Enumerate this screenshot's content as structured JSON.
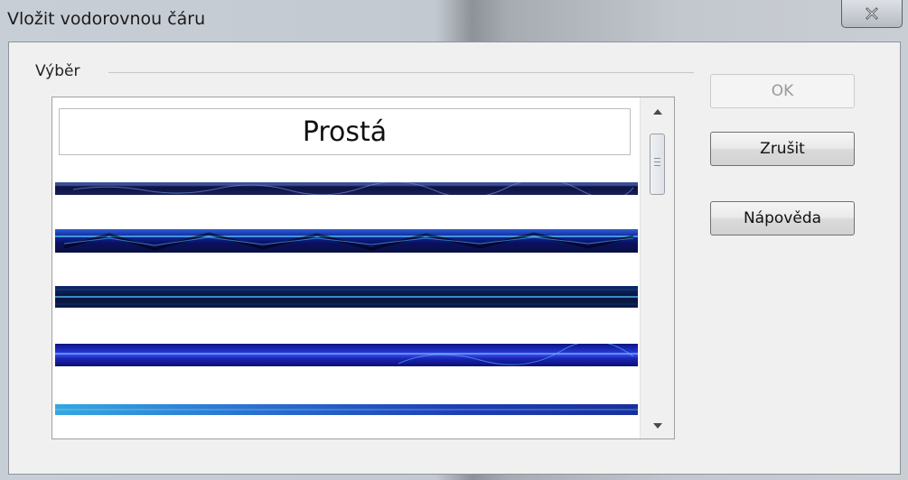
{
  "window": {
    "title": "Vložit vodorovnou čáru",
    "close_label": "X"
  },
  "group": {
    "label": "Výběr"
  },
  "list": {
    "items": [
      {
        "label": "Prostá",
        "type": "plain"
      },
      {
        "type": "image-rule",
        "style": "dark-blue-thin"
      },
      {
        "type": "image-rule",
        "style": "blue-lightning"
      },
      {
        "type": "image-rule",
        "style": "dark-cyan-line"
      },
      {
        "type": "image-rule",
        "style": "royal-blue"
      },
      {
        "type": "image-rule",
        "style": "blue-partial"
      }
    ]
  },
  "buttons": {
    "ok_label": "OK",
    "cancel_label": "Zrušit",
    "help_label": "Nápověda"
  },
  "colors": {
    "rule_dark": "#0a0f3a",
    "rule_blue": "#1c2fb8",
    "rule_cyan": "#3fa6e8",
    "button_disabled_text": "#9a9a9a"
  }
}
